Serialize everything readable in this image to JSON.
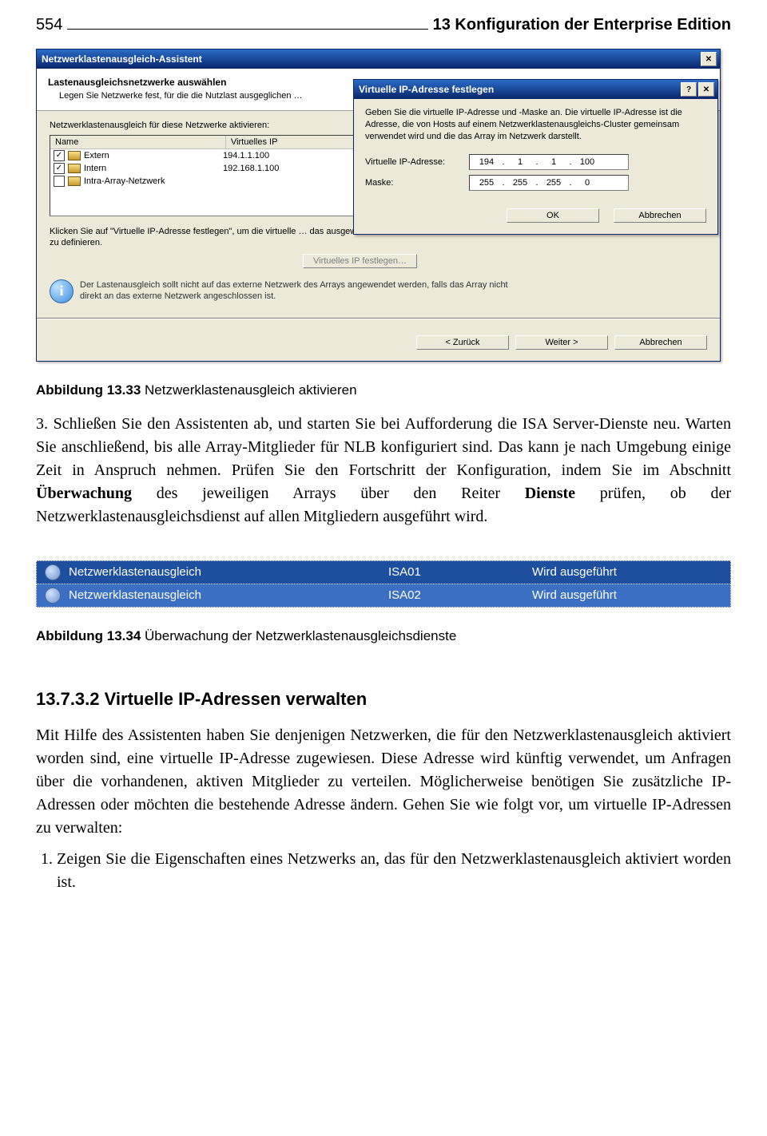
{
  "header": {
    "page_number": "554",
    "chapter_title": "13 Konfiguration der Enterprise Edition"
  },
  "wizard": {
    "window_title": "Netzwerklastenausgleich-Assistent",
    "banner_title": "Lastenausgleichsnetzwerke auswählen",
    "banner_subtitle": "Legen Sie Netzwerke fest, für die die Nutzlast ausgeglichen …",
    "enable_label": "Netzwerklastenausgleich für diese Netzwerke aktivieren:",
    "columns": {
      "name": "Name",
      "vip": "Virtuelles IP"
    },
    "rows": [
      {
        "checked": true,
        "name": "Extern",
        "vip": "194.1.1.100"
      },
      {
        "checked": true,
        "name": "Intern",
        "vip": "192.168.1.100"
      },
      {
        "checked": false,
        "name": "Intra-Array-Netzwerk",
        "vip": ""
      }
    ],
    "define_note": "Klicken Sie auf \"Virtuelle IP-Adresse festlegen\", um die virtuelle … das ausgewählte Netzwerk zu definieren.",
    "define_btn": "Virtuelles IP festlegen…",
    "info_note": "Der Lastenausgleich sollt nicht auf das externe Netzwerk des Arrays angewendet werden, falls das Array nicht direkt an das externe Netzwerk angeschlossen ist.",
    "footer": {
      "back": "< Zurück",
      "next": "Weiter >",
      "cancel": "Abbrechen"
    }
  },
  "vip_dialog": {
    "title": "Virtuelle IP-Adresse festlegen",
    "intro": "Geben Sie die virtuelle IP-Adresse und -Maske an. Die virtuelle IP-Adresse ist die Adresse, die von Hosts auf einem Netzwerklastenausgleichs-Cluster gemeinsam verwendet wird und die das Array im Netzwerk darstellt.",
    "ip_label": "Virtuelle IP-Adresse:",
    "mask_label": "Maske:",
    "ip": {
      "o1": "194",
      "o2": "1",
      "o3": "1",
      "o4": "100"
    },
    "mask": {
      "o1": "255",
      "o2": "255",
      "o3": "255",
      "o4": "0"
    },
    "ok": "OK",
    "cancel": "Abbrechen"
  },
  "caption1": {
    "bold": "Abbildung 13.33",
    "text": " Netzwerklastenausgleich aktivieren"
  },
  "para1_pre": "3. Schließen Sie den Assistenten ab, und starten Sie bei Aufforderung die ISA Server-Dienste neu. Warten Sie anschließend, bis alle Array-Mitglieder für NLB konfiguriert sind. Das kann je nach Umgebung einige Zeit in Anspruch nehmen. Prüfen Sie den Fortschritt der Konfiguration, indem Sie im Abschnitt ",
  "para1_b1": "Überwachung",
  "para1_mid": " des jeweiligen Arrays über den Reiter ",
  "para1_b2": "Dienste",
  "para1_post": " prüfen, ob der Netzwerklastenausgleichsdienst auf allen Mitgliedern ausgeführt wird.",
  "monitor": {
    "service": "Netzwerklastenausgleich",
    "status": "Wird ausgeführt",
    "rows": [
      {
        "server": "ISA01"
      },
      {
        "server": "ISA02"
      }
    ]
  },
  "caption2": {
    "bold": "Abbildung 13.34",
    "text": " Überwachung der Netzwerklastenausgleichsdienste"
  },
  "section": {
    "heading": "13.7.3.2 Virtuelle IP-Adressen verwalten",
    "para": "Mit Hilfe des Assistenten haben Sie denjenigen Netzwerken, die für den Netzwerklastenausgleich aktiviert worden sind, eine virtuelle IP-Adresse zugewiesen. Diese Adresse wird künftig verwendet, um Anfragen über die vorhandenen, aktiven Mitglieder zu verteilen. Möglicherweise benötigen Sie zusätzliche IP-Adressen oder möchten die bestehende Adresse ändern. Gehen Sie wie folgt vor, um virtuelle IP-Adressen zu verwalten:",
    "step1": "Zeigen Sie die Eigenschaften eines Netzwerks an, das für den Netzwerklastenausgleich aktiviert worden ist."
  }
}
